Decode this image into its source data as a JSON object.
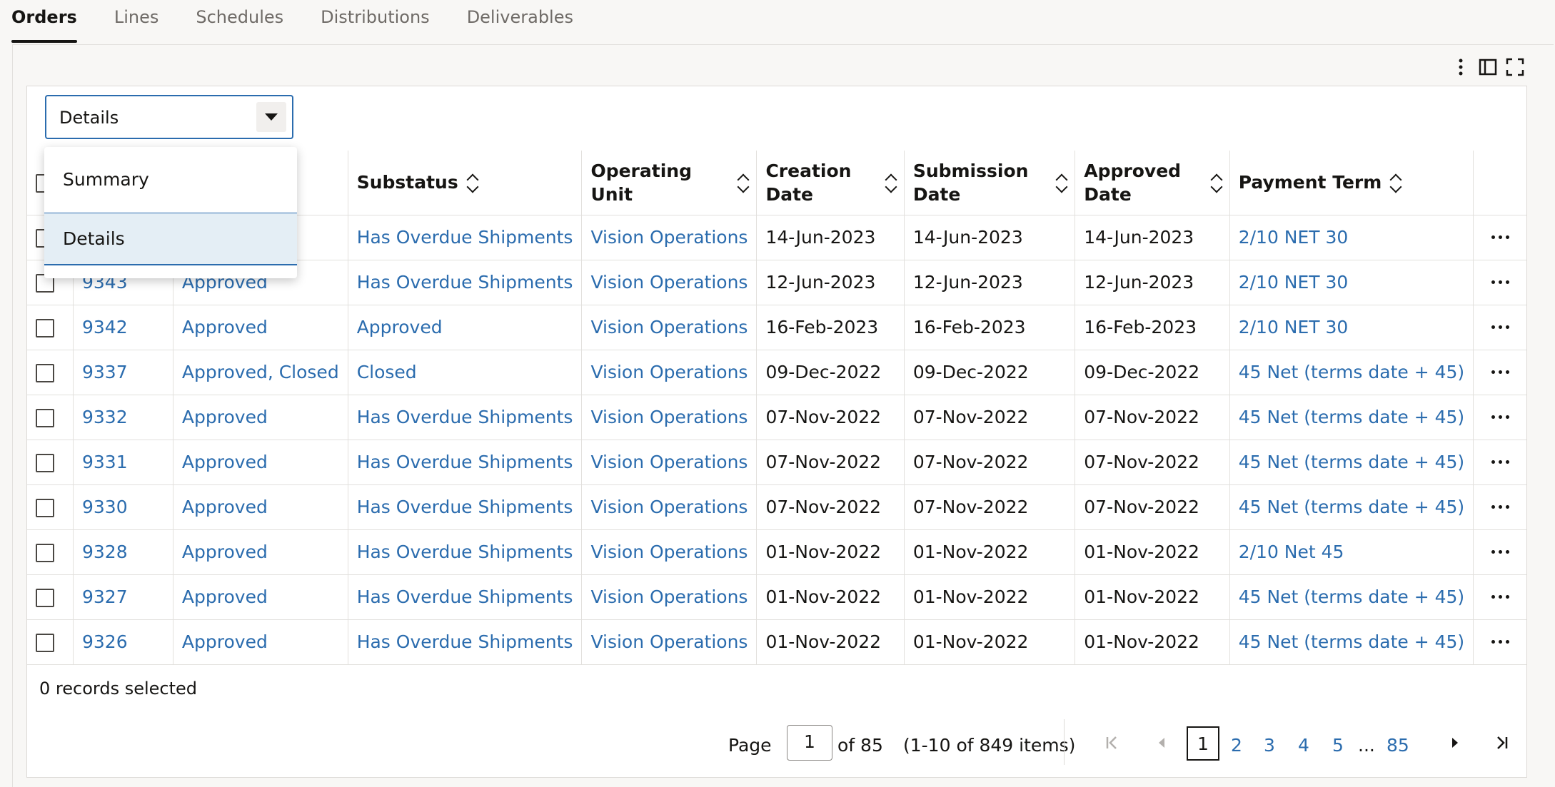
{
  "tabs": [
    "Orders",
    "Lines",
    "Schedules",
    "Distributions",
    "Deliverables"
  ],
  "view_select": {
    "value": "Details",
    "options": [
      "Summary",
      "Details"
    ],
    "selected": "Details"
  },
  "columns": [
    "Substatus",
    "Operating Unit",
    "Creation Date",
    "Submission Date",
    "Approved Date",
    "Payment Term"
  ],
  "column_lines": {
    "operating_unit": [
      "Operating",
      "Unit"
    ],
    "creation_date": [
      "Creation",
      "Date"
    ],
    "submission_date": [
      "Submission",
      "Date"
    ],
    "approved_date": [
      "Approved",
      "Date"
    ]
  },
  "rows": [
    {
      "order": "",
      "status": "",
      "substatus": "Has Overdue Shipments",
      "ou": "Vision Operations",
      "created": "14-Jun-2023",
      "submitted": "14-Jun-2023",
      "approved": "14-Jun-2023",
      "term": "2/10 NET 30"
    },
    {
      "order": "9343",
      "status": "Approved",
      "substatus": "Has Overdue Shipments",
      "ou": "Vision Operations",
      "created": "12-Jun-2023",
      "submitted": "12-Jun-2023",
      "approved": "12-Jun-2023",
      "term": "2/10 NET 30"
    },
    {
      "order": "9342",
      "status": "Approved",
      "substatus": "Approved",
      "ou": "Vision Operations",
      "created": "16-Feb-2023",
      "submitted": "16-Feb-2023",
      "approved": "16-Feb-2023",
      "term": "2/10 NET 30"
    },
    {
      "order": "9337",
      "status": "Approved, Closed",
      "substatus": "Closed",
      "ou": "Vision Operations",
      "created": "09-Dec-2022",
      "submitted": "09-Dec-2022",
      "approved": "09-Dec-2022",
      "term": "45 Net (terms date + 45)"
    },
    {
      "order": "9332",
      "status": "Approved",
      "substatus": "Has Overdue Shipments",
      "ou": "Vision Operations",
      "created": "07-Nov-2022",
      "submitted": "07-Nov-2022",
      "approved": "07-Nov-2022",
      "term": "45 Net (terms date + 45)"
    },
    {
      "order": "9331",
      "status": "Approved",
      "substatus": "Has Overdue Shipments",
      "ou": "Vision Operations",
      "created": "07-Nov-2022",
      "submitted": "07-Nov-2022",
      "approved": "07-Nov-2022",
      "term": "45 Net (terms date + 45)"
    },
    {
      "order": "9330",
      "status": "Approved",
      "substatus": "Has Overdue Shipments",
      "ou": "Vision Operations",
      "created": "07-Nov-2022",
      "submitted": "07-Nov-2022",
      "approved": "07-Nov-2022",
      "term": "45 Net (terms date + 45)"
    },
    {
      "order": "9328",
      "status": "Approved",
      "substatus": "Has Overdue Shipments",
      "ou": "Vision Operations",
      "created": "01-Nov-2022",
      "submitted": "01-Nov-2022",
      "approved": "01-Nov-2022",
      "term": "2/10 Net 45"
    },
    {
      "order": "9327",
      "status": "Approved",
      "substatus": "Has Overdue Shipments",
      "ou": "Vision Operations",
      "created": "01-Nov-2022",
      "submitted": "01-Nov-2022",
      "approved": "01-Nov-2022",
      "term": "45 Net (terms date + 45)"
    },
    {
      "order": "9326",
      "status": "Approved",
      "substatus": "Has Overdue Shipments",
      "ou": "Vision Operations",
      "created": "01-Nov-2022",
      "submitted": "01-Nov-2022",
      "approved": "01-Nov-2022",
      "term": "45 Net (terms date + 45)"
    }
  ],
  "footer": {
    "selected": "0 records selected",
    "page_label": "Page",
    "page_value": "1",
    "of_pages": "of 85",
    "items": "(1-10 of 849 items)",
    "pages": [
      "1",
      "2",
      "3",
      "4",
      "5",
      "...",
      "85"
    ]
  },
  "icons": [
    "more-vertical-icon",
    "panel-icon",
    "fullscreen-icon",
    "first-page-icon",
    "prev-page-icon",
    "next-page-icon",
    "last-page-icon"
  ]
}
